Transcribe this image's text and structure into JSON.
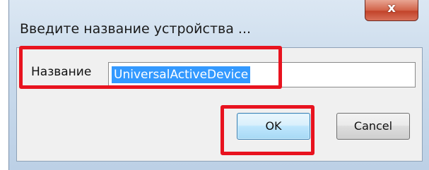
{
  "dialog": {
    "title": "Введите название устройства ...",
    "close_icon": "close-icon",
    "close_glyph": "x"
  },
  "form": {
    "name_label": "Название",
    "name_value": "UniversalActiveDevice"
  },
  "buttons": {
    "ok_label": "OK",
    "cancel_label": "Cancel"
  },
  "colors": {
    "selection": "#3399ff",
    "highlight": "#e8131f",
    "close_button": "#c2432a"
  }
}
